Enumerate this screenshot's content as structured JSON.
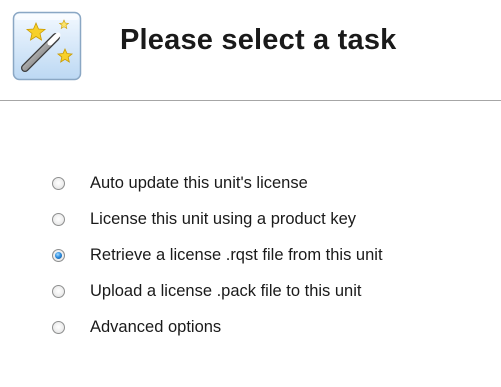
{
  "header": {
    "title": "Please select a task",
    "icon": "wizard-wand-icon"
  },
  "colors": {
    "title_text": "#1a1a1a",
    "divider": "#a6a6a6",
    "radio_selected": "#2f8fe0"
  },
  "task_options": {
    "selected_index": 2,
    "items": [
      {
        "label": "Auto update this unit's license",
        "checked": false
      },
      {
        "label": "License this unit using a product key",
        "checked": false
      },
      {
        "label": "Retrieve a license .rqst file from this unit",
        "checked": true
      },
      {
        "label": "Upload a license .pack file to this unit",
        "checked": false
      },
      {
        "label": "Advanced options",
        "checked": false
      }
    ]
  }
}
